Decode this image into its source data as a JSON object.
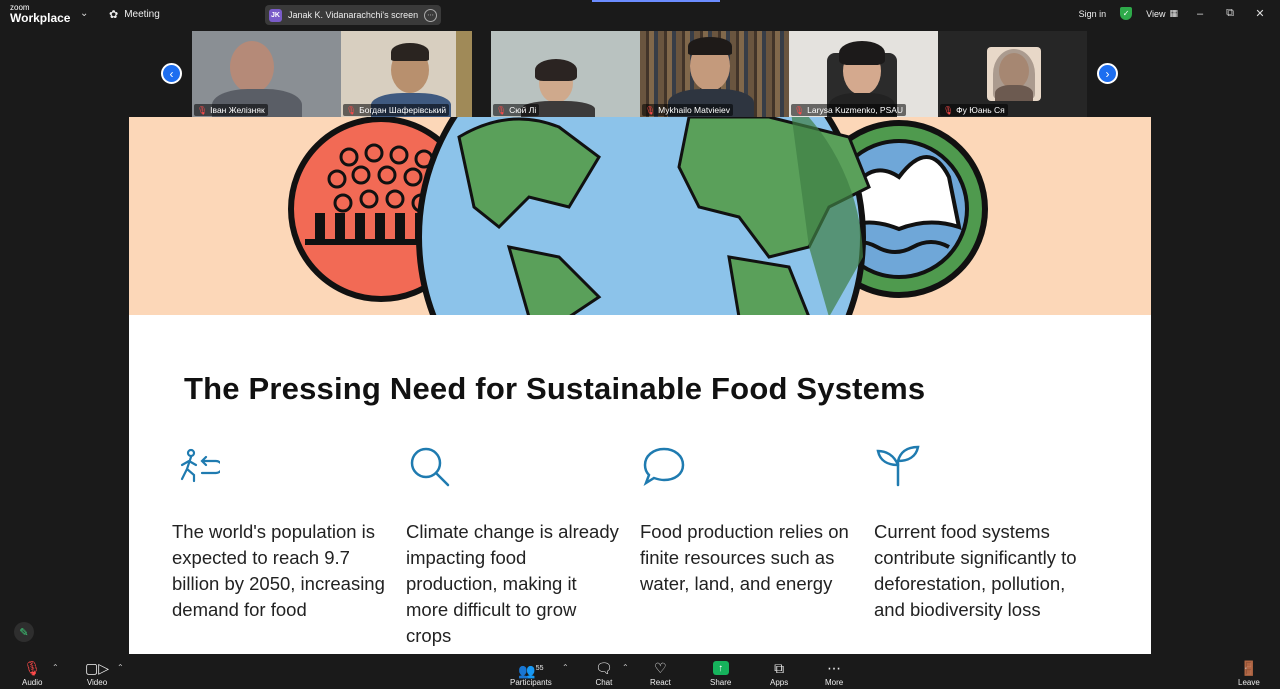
{
  "app": {
    "logo_small": "zoom",
    "logo_big": "Workplace",
    "meeting_label": "Meeting"
  },
  "share_pill": {
    "initials": "JK",
    "label": "Janak K. Vidanarachchi's screen"
  },
  "top_right": {
    "sign_in": "Sign in",
    "view": "View"
  },
  "participants": [
    {
      "name": "Іван Желізняк"
    },
    {
      "name": "Богдан Шаферівський"
    },
    {
      "name": "Сюй Лі"
    },
    {
      "name": "Mykhailo Matvieiev"
    },
    {
      "name": "Larysa Kuzmenko, PSAU"
    },
    {
      "name": "Фу Юань Ся"
    }
  ],
  "slide": {
    "title": "The Pressing Need for Sustainable Food Systems",
    "columns": [
      {
        "icon": "walking-person-icon",
        "text": "The world's population is expected to reach 9.7 billion by 2050, increasing demand for food"
      },
      {
        "icon": "magnifier-icon",
        "text": "Climate change is already impacting food production, making it more difficult to grow crops"
      },
      {
        "icon": "speech-bubble-icon",
        "text": "Food production relies on finite resources such as water, land, and energy"
      },
      {
        "icon": "sprout-icon",
        "text": "Current food systems contribute significantly to deforestation, pollution, and biodiversity loss"
      }
    ],
    "colors": {
      "banner_bg": "#fcd7b8",
      "icon_blue": "#1f7bb0"
    }
  },
  "toolbar": {
    "audio": "Audio",
    "video": "Video",
    "participants": "Participants",
    "participants_count": "55",
    "chat": "Chat",
    "react": "React",
    "share": "Share",
    "apps": "Apps",
    "more": "More",
    "leave": "Leave"
  }
}
